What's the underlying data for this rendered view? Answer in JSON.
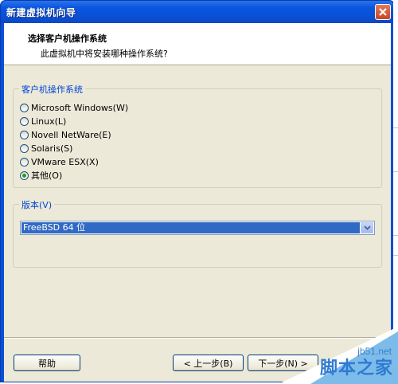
{
  "window": {
    "title": "新建虚拟机向导"
  },
  "header": {
    "title": "选择客户机操作系统",
    "subtitle": "此虚拟机中将安装哪种操作系统?"
  },
  "os_group": {
    "label": "客户机操作系统",
    "options": [
      {
        "label": "Microsoft Windows(W)",
        "selected": false
      },
      {
        "label": "Linux(L)",
        "selected": false
      },
      {
        "label": "Novell NetWare(E)",
        "selected": false
      },
      {
        "label": "Solaris(S)",
        "selected": false
      },
      {
        "label": "VMware ESX(X)",
        "selected": false
      },
      {
        "label": "其他(O)",
        "selected": true
      }
    ]
  },
  "version_group": {
    "label": "版本(V)",
    "selected": "FreeBSD 64 位"
  },
  "buttons": {
    "help": "帮助",
    "back": "< 上一步(B)",
    "next": "下一步(N) >"
  },
  "watermark": {
    "url": "jb51.net",
    "text": "脚本之家"
  }
}
